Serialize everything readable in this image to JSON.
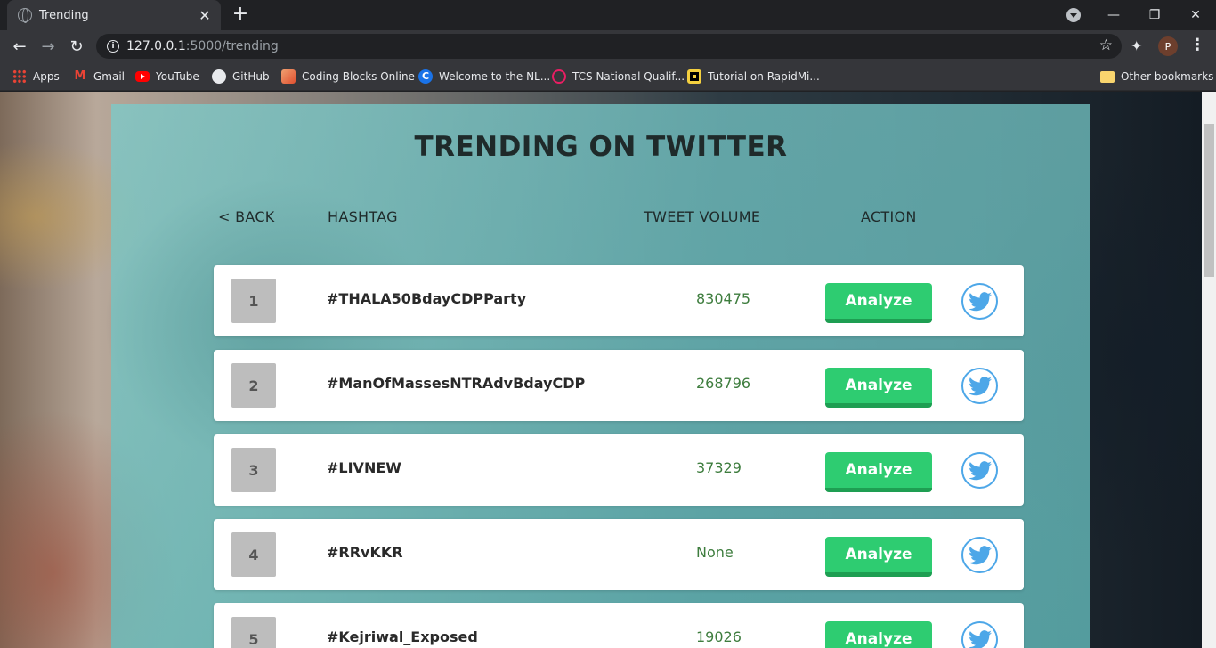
{
  "browser": {
    "tab_title": "Trending",
    "url_host": "127.0.0.1",
    "url_path": ":5000/trending",
    "profile_initial": "P",
    "bookmarks": [
      {
        "label": "Apps",
        "icon": "apps-grid-icon",
        "color": "#ea4335"
      },
      {
        "label": "Gmail",
        "icon": "gmail-icon",
        "color": "#ea4335"
      },
      {
        "label": "YouTube",
        "icon": "youtube-icon",
        "color": "#ff0000"
      },
      {
        "label": "GitHub",
        "icon": "github-icon",
        "color": "#ffffff"
      },
      {
        "label": "Coding Blocks Online",
        "icon": "coding-blocks-icon",
        "color": "#e57340"
      },
      {
        "label": "Welcome to the NL...",
        "icon": "c-logo-icon",
        "color": "#1a73e8"
      },
      {
        "label": "TCS National Qualif...",
        "icon": "tcs-icon",
        "color": "#e91e63"
      },
      {
        "label": "Tutorial on RapidMi...",
        "icon": "rapidminer-icon",
        "color": "#f4d03f"
      }
    ],
    "other_bookmarks": "Other bookmarks"
  },
  "page": {
    "title": "TRENDING ON TWITTER",
    "headers": {
      "back": "< BACK",
      "hashtag": "HASHTAG",
      "volume": "TWEET VOLUME",
      "action": "ACTION"
    },
    "button_label": "Analyze",
    "accent_color": "#2ecc71",
    "twitter_color": "#4da7e8",
    "trends": [
      {
        "rank": "1",
        "hashtag": "#THALA50BdayCDPParty",
        "volume": "830475"
      },
      {
        "rank": "2",
        "hashtag": "#ManOfMassesNTRAdvBdayCDP",
        "volume": "268796"
      },
      {
        "rank": "3",
        "hashtag": "#LIVNEW",
        "volume": "37329"
      },
      {
        "rank": "4",
        "hashtag": "#RRvKKR",
        "volume": "None"
      },
      {
        "rank": "5",
        "hashtag": "#Kejriwal_Exposed",
        "volume": "19026"
      }
    ]
  }
}
